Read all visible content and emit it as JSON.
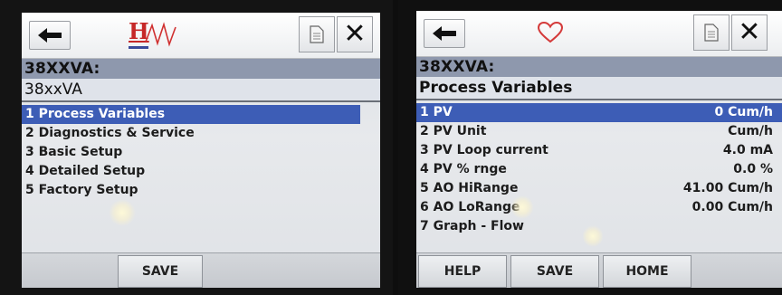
{
  "left_screen": {
    "logo_text": "H",
    "title": "38XXVA:",
    "subtitle": "38xxVA",
    "menu": [
      {
        "label": "1 Process Variables"
      },
      {
        "label": "2 Diagnostics & Service"
      },
      {
        "label": "3 Basic Setup"
      },
      {
        "label": "4 Detailed Setup"
      },
      {
        "label": "5 Factory Setup"
      }
    ],
    "buttons": {
      "save": "SAVE"
    }
  },
  "right_screen": {
    "title": "38XXVA:",
    "subtitle": "Process Variables",
    "menu": [
      {
        "label": "1 PV",
        "value": "0 Cum/h"
      },
      {
        "label": "2 PV Unit",
        "value": "Cum/h"
      },
      {
        "label": "3 PV Loop current",
        "value": "4.0 mA"
      },
      {
        "label": "4 PV % rnge",
        "value": "0.0 %"
      },
      {
        "label": "5 AO HiRange",
        "value": "41.00 Cum/h"
      },
      {
        "label": "6 AO LoRange",
        "value": "0.00 Cum/h"
      },
      {
        "label": "7 Graph - Flow",
        "value": ""
      }
    ],
    "buttons": {
      "help": "HELP",
      "save": "SAVE",
      "home": "HOME"
    }
  },
  "icons": {
    "back": "back-arrow-icon",
    "document": "document-icon",
    "close": "close-icon",
    "heart": "heart-icon",
    "logo": "hart-logo-icon"
  },
  "colors": {
    "selection": "#3d5db6",
    "title_bar": "#8e98ad",
    "heart": "#d43a3a",
    "logo": "#c62828"
  }
}
